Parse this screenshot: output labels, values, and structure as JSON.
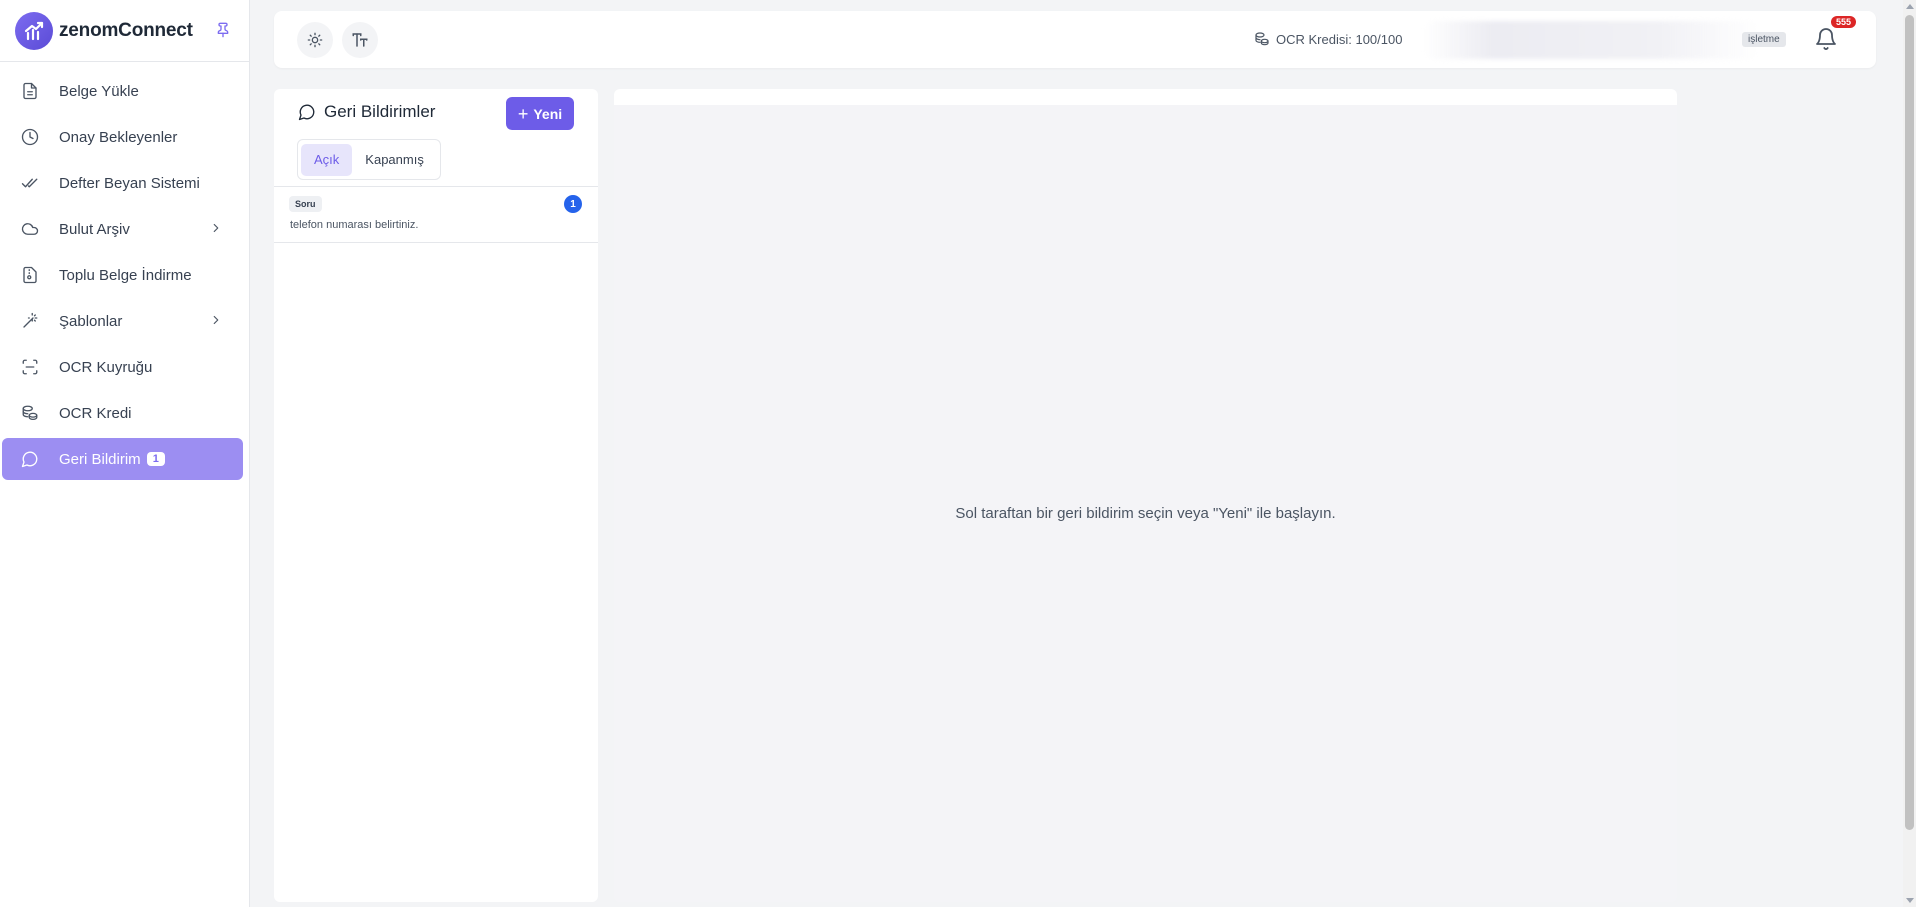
{
  "brand": {
    "name": "zenomConnect"
  },
  "sidebar": {
    "items": [
      {
        "label": "Belge Yükle",
        "icon": "file-icon"
      },
      {
        "label": "Onay Bekleyenler",
        "icon": "clock-icon"
      },
      {
        "label": "Defter Beyan Sistemi",
        "icon": "double-check-icon"
      },
      {
        "label": "Bulut Arşiv",
        "icon": "cloud-icon",
        "has_submenu": true
      },
      {
        "label": "Toplu Belge İndirme",
        "icon": "file-archive-icon"
      },
      {
        "label": "Şablonlar",
        "icon": "magic-wand-icon",
        "has_submenu": true
      },
      {
        "label": "OCR Kuyruğu",
        "icon": "scan-icon"
      },
      {
        "label": "OCR Kredi",
        "icon": "coins-icon"
      },
      {
        "label": "Geri Bildirim",
        "icon": "message-circle-icon",
        "badge": "1",
        "active": true
      }
    ]
  },
  "topbar": {
    "ocr_credit": "OCR Kredisi: 100/100",
    "business_badge": "işletme",
    "notification_count": "555"
  },
  "feedback": {
    "title": "Geri Bildirimler",
    "new_label": "Yeni",
    "tabs": [
      {
        "label": "Açık",
        "active": true
      },
      {
        "label": "Kapanmış",
        "active": false
      }
    ],
    "items": [
      {
        "tag": "Soru",
        "text": "telefon numarası belirtiniz.",
        "count": "1"
      }
    ]
  },
  "detail": {
    "empty_message": "Sol taraftan bir geri bildirim seçin veya \"Yeni\" ile başlayın."
  },
  "colors": {
    "accent": "#6d5ce8",
    "active_nav": "#9c8ef2",
    "notification": "#dc2626",
    "count_badge": "#2563eb"
  }
}
